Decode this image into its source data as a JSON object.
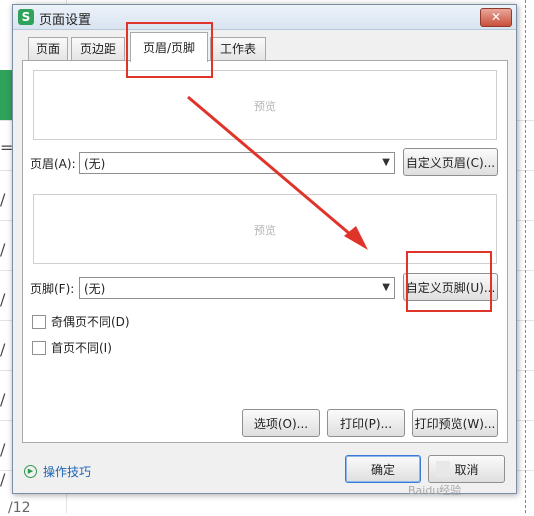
{
  "dialog": {
    "title": "页面设置",
    "app_icon": "S",
    "close_label": "✕"
  },
  "tabs": [
    {
      "label": "页面"
    },
    {
      "label": "页边距"
    },
    {
      "label": "页眉/页脚"
    },
    {
      "label": "工作表"
    }
  ],
  "header": {
    "preview_label": "预览",
    "field_label": "页眉(A):",
    "selected": "(无)",
    "custom_button": "自定义页眉(C)..."
  },
  "footer": {
    "preview_label": "预览",
    "field_label": "页脚(F):",
    "selected": "(无)",
    "custom_button": "自定义页脚(U)..."
  },
  "checkboxes": {
    "odd_even": "奇偶页不同(D)",
    "first_page": "首页不同(I)"
  },
  "buttons": {
    "options": "选项(O)...",
    "print": "打印(P)...",
    "print_preview": "打印预览(W)...",
    "ok": "确定",
    "cancel": "取消"
  },
  "tips_link": "操作技巧",
  "sheet": {
    "mark_top": "=",
    "marks": [
      "/",
      "/",
      "/",
      "/",
      "/",
      "/",
      "/"
    ],
    "bottom_number": "/12"
  },
  "watermark": "Baidu经验",
  "colors": {
    "annotation_red": "#e0342b",
    "link_blue": "#1b63b5",
    "brand_green": "#2fa35a"
  }
}
